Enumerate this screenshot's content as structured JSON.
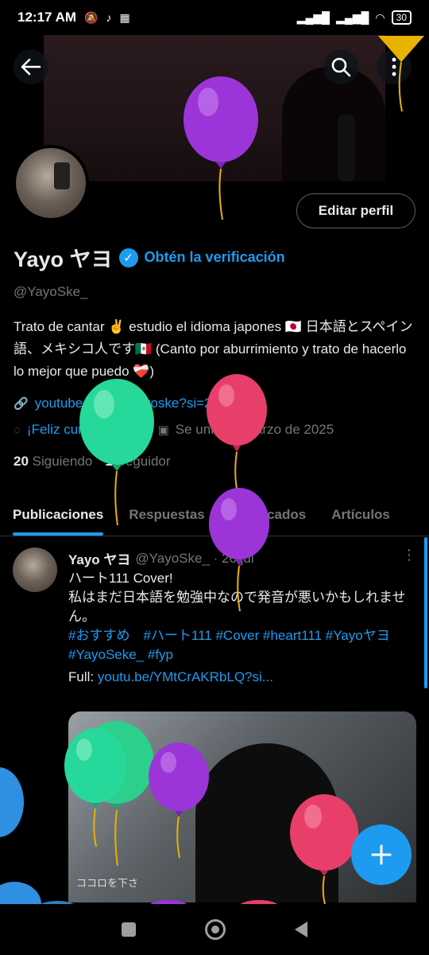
{
  "status_bar": {
    "time": "12:17 AM",
    "battery": "30"
  },
  "profile": {
    "edit_button": "Editar perfil",
    "display_name": "Yayo ヤヨ",
    "verify_text": "Obtén la verificación",
    "handle": "@YayoSke_",
    "bio": "Trato de cantar ✌️ estudio el idioma japones 🇯🇵 日本語とスペイン語、メキシコ人です🇲🇽  (Canto por aburrimiento y trato de hacerlo lo mejor que puedo ❤️‍🩹)",
    "link": "youtube.com/@yayoske?si=2z...",
    "birthday": "¡Feliz cumpleaños!",
    "joined": "Se unió en marzo de 2025",
    "following_count": "20",
    "following_label": "Siguiendo",
    "followers_count": "1",
    "followers_label": "Seguidor"
  },
  "tabs": [
    "Publicaciones",
    "Respuestas",
    "Destacados",
    "Artículos"
  ],
  "post": {
    "name": "Yayo ヤヨ",
    "handle_date": "@YayoSke_ · 26 jul",
    "line1": "ハート111 Cover!",
    "line2": "私はまだ日本語を勉強中なので発音が悪いかもしれません。",
    "hashtags": "#おすすめ　#ハート111 #Cover #heart111 #Yayoヤヨ #YayoSeke_ #fyp",
    "full_label": "Full:",
    "full_url": "youtu.be/YMtCrAKRbLQ?si...",
    "media_caption": "ココロを下さ"
  },
  "icons": {
    "back": "arrow-left-icon",
    "search": "search-icon",
    "more": "more-vertical-icon",
    "link": "link-icon",
    "balloon": "birthday-icon",
    "calendar": "calendar-icon",
    "compose": "plus-icon"
  },
  "colors": {
    "accent": "#1d9bf0",
    "balloon_purple": "#9b35d8",
    "balloon_green": "#26d89a",
    "balloon_red": "#e83f6a",
    "party_yellow": "#e8b200"
  }
}
